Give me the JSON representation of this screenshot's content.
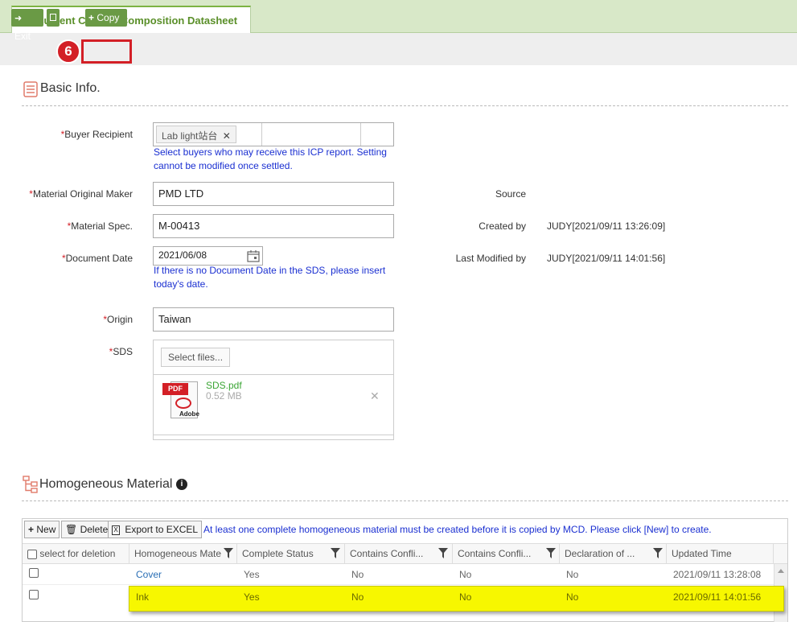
{
  "tab": {
    "title": "Document Center - Composition Datasheet"
  },
  "toolbar": {
    "exit_label": "Exit",
    "copy_label": "Copy",
    "step_badge": "6"
  },
  "basic": {
    "title": "Basic Info.",
    "buyer_label": "Buyer Recipient",
    "buyer_chip": "Lab light站台",
    "buyer_hint_1": "Select buyers who may receive this ICP report. Setting",
    "buyer_hint_2": "cannot be modified once settled.",
    "maker_label": "Material Original Maker",
    "maker_value": "PMD LTD",
    "spec_label": "Material Spec.",
    "spec_value": "M-00413",
    "date_label": "Document Date",
    "date_value": "2021/06/08",
    "date_hint_1": "If there is no Document Date in the SDS, please insert",
    "date_hint_2": "today's date.",
    "origin_label": "Origin",
    "origin_value": "Taiwan",
    "sds_label": "SDS",
    "select_files": "Select files...",
    "file_name": "SDS.pdf",
    "file_size": "0.52 MB",
    "pdf_text": "PDF",
    "adobe_text": "Adobe",
    "source_label": "Source",
    "created_label": "Created by",
    "created_value": "JUDY[2021/09/11 13:26:09]",
    "modified_label": "Last Modified by",
    "modified_value": "JUDY[2021/09/11 14:01:56]"
  },
  "homo": {
    "title": "Homogeneous Material",
    "new_label": "New",
    "delete_label": "Delete",
    "export_label": "Export to EXCEL",
    "notice": "At least one complete homogeneous material must be created before it is copied by MCD. Please click [New] to create.",
    "columns": [
      "select for deletion",
      "Homogeneous Mate",
      "Complete Status",
      "Contains Confli...",
      "Contains Confli...",
      "Declaration of ...",
      "Updated Time"
    ],
    "rows": [
      [
        "Cover",
        "Yes",
        "No",
        "No",
        "No",
        "2021/09/11 13:28:08"
      ],
      [
        "Ink",
        "Yes",
        "No",
        "No",
        "No",
        "2021/09/11 14:01:56"
      ]
    ]
  }
}
